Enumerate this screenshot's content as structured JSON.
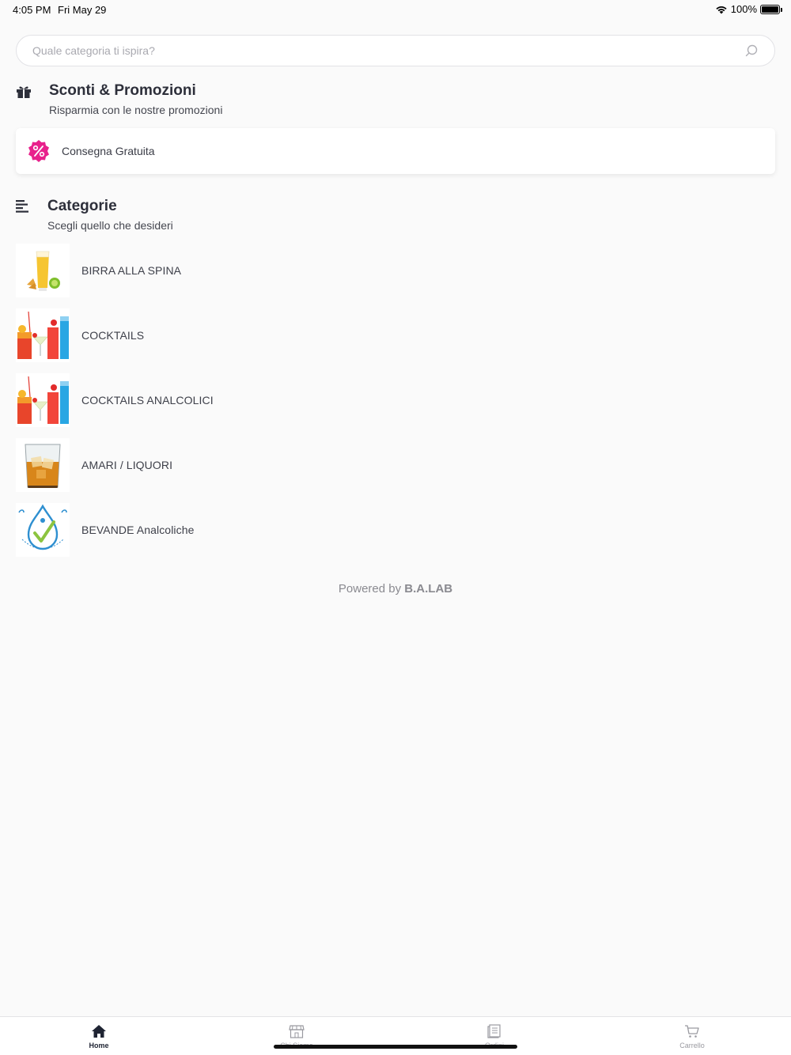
{
  "status_bar": {
    "time": "4:05 PM",
    "date": "Fri May 29",
    "battery": "100%"
  },
  "search": {
    "placeholder": "Quale categoria ti ispira?",
    "icon": "search-icon"
  },
  "promotions": {
    "icon": "gift-icon",
    "title": "Sconti & Promozioni",
    "subtitle": "Risparmia con le nostre promozioni",
    "items": [
      {
        "label": "Consegna Gratuita",
        "icon": "percent-badge-icon",
        "color": "#e8218c"
      }
    ]
  },
  "categories": {
    "icon": "list-icon",
    "title": "Categorie",
    "subtitle": "Scegli quello che desideri",
    "items": [
      {
        "label": "BIRRA ALLA SPINA",
        "image": "beer-glass-image"
      },
      {
        "label": "COCKTAILS",
        "image": "cocktails-image"
      },
      {
        "label": "COCKTAILS ANALCOLICI",
        "image": "cocktails-image"
      },
      {
        "label": "AMARI / LIQUORI",
        "image": "whisky-glass-image"
      },
      {
        "label": "BEVANDE Analcoliche",
        "image": "alcohol-free-logo"
      }
    ]
  },
  "footer": {
    "powered_prefix": "Powered by",
    "powered_brand": "B.A.LAB"
  },
  "tab_bar": {
    "tabs": [
      {
        "label": "Home",
        "icon": "home-icon",
        "active": true
      },
      {
        "label": "Chi Siamo",
        "icon": "store-icon",
        "active": false
      },
      {
        "label": "Ordini",
        "icon": "orders-icon",
        "active": false
      },
      {
        "label": "Carrello",
        "icon": "cart-icon",
        "active": false
      }
    ]
  },
  "colors": {
    "background": "#fafafa",
    "accent_promo": "#e8218c",
    "text_dark": "#2d2f3a"
  }
}
